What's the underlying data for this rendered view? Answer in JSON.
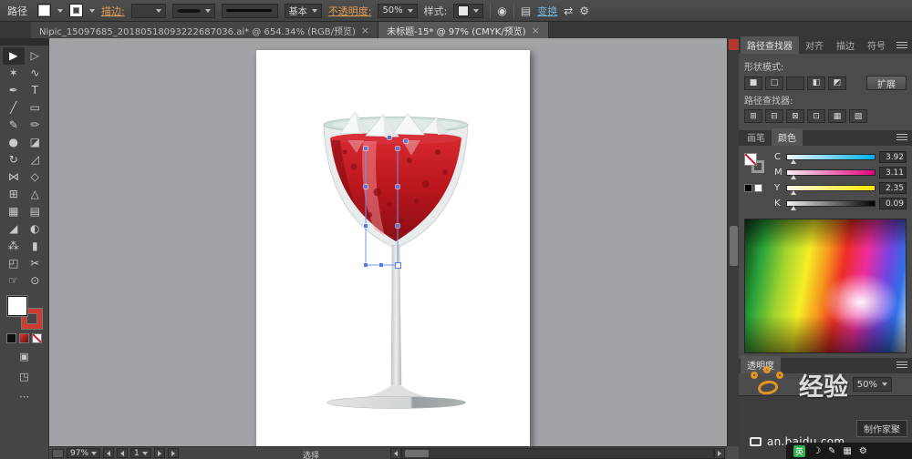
{
  "ui": {
    "close_glyph": "×"
  },
  "control_bar": {
    "selection_type": "路径",
    "stroke_label": "描边:",
    "brush_name": "基本",
    "opacity_label": "不透明度:",
    "opacity_value": "50%",
    "style_label": "样式:",
    "transform_link": "变换",
    "icons": {
      "recolor": "◉",
      "align": "▤",
      "swap": "⇄",
      "settings": "⚙"
    }
  },
  "document_tabs": [
    {
      "title": "Nipic_15097685_20180518093222687036.ai* @ 654.34% (RGB/预览)"
    },
    {
      "title": "未标题-15* @ 97% (CMYK/预览)"
    }
  ],
  "tools": [
    {
      "name": "selection",
      "glyph": "▶"
    },
    {
      "name": "direct-selection",
      "glyph": "▷"
    },
    {
      "name": "magic-wand",
      "glyph": "✶"
    },
    {
      "name": "lasso",
      "glyph": "∿"
    },
    {
      "name": "pen",
      "glyph": "✒"
    },
    {
      "name": "type",
      "glyph": "T"
    },
    {
      "name": "line-segment",
      "glyph": "╱"
    },
    {
      "name": "rectangle",
      "glyph": "▭"
    },
    {
      "name": "paintbrush",
      "glyph": "✎"
    },
    {
      "name": "pencil",
      "glyph": "✏"
    },
    {
      "name": "blob-brush",
      "glyph": "●"
    },
    {
      "name": "eraser",
      "glyph": "◪"
    },
    {
      "name": "rotate",
      "glyph": "↻"
    },
    {
      "name": "scale",
      "glyph": "◿"
    },
    {
      "name": "width",
      "glyph": "⋈"
    },
    {
      "name": "free-transform",
      "glyph": "◇"
    },
    {
      "name": "shape-builder",
      "glyph": "⊞"
    },
    {
      "name": "perspective-grid",
      "glyph": "△"
    },
    {
      "name": "mesh",
      "glyph": "▦"
    },
    {
      "name": "gradient",
      "glyph": "▤"
    },
    {
      "name": "eyedropper",
      "glyph": "◢"
    },
    {
      "name": "blend",
      "glyph": "◐"
    },
    {
      "name": "symbol-sprayer",
      "glyph": "⁂"
    },
    {
      "name": "column-graph",
      "glyph": "▮"
    },
    {
      "name": "artboard",
      "glyph": "◰"
    },
    {
      "name": "slice",
      "glyph": "✂"
    },
    {
      "name": "hand",
      "glyph": "☞"
    },
    {
      "name": "zoom",
      "glyph": "⊙"
    }
  ],
  "tool_extras": {
    "drawing_mode": "▣",
    "screen_mode": "◳",
    "more": "⋯"
  },
  "panels": {
    "pathfinder": {
      "tabs": [
        "路径查找器",
        "对齐",
        "描边",
        "符号"
      ],
      "shape_modes_label": "形状模式:",
      "shape_modes": [
        {
          "name": "unite",
          "glyph": "■"
        },
        {
          "name": "minus-front",
          "glyph": "□"
        },
        {
          "name": "intersect",
          "glyph": "◧"
        },
        {
          "name": "exclude",
          "glyph": "◩"
        }
      ],
      "expand_label": "扩展",
      "pathfinders_label": "路径查找器:",
      "pathfinders": [
        {
          "name": "divide",
          "glyph": "⊞"
        },
        {
          "name": "trim",
          "glyph": "⊟"
        },
        {
          "name": "merge",
          "glyph": "⊠"
        },
        {
          "name": "crop",
          "glyph": "⊡"
        },
        {
          "name": "outline",
          "glyph": "▦"
        },
        {
          "name": "minus-back",
          "glyph": "▧"
        }
      ]
    },
    "color": {
      "tabs": [
        "画笔",
        "颜色"
      ],
      "channels": [
        {
          "label": "C",
          "value": "3.92",
          "color": "#00aeef"
        },
        {
          "label": "M",
          "value": "3.11",
          "color": "#e6007e"
        },
        {
          "label": "Y",
          "value": "2.35",
          "color": "#ffe800"
        },
        {
          "label": "K",
          "value": "0.09",
          "color": "#000000"
        }
      ]
    },
    "transparency": {
      "title": "透明度",
      "opacity_value": "50%"
    }
  },
  "watermark": {
    "brand": "经验",
    "url": "an.baidu.com",
    "badge": "制作家聚"
  },
  "status_bar": {
    "zoom": "97%",
    "artboard_number": "1",
    "tool_hint": "选择"
  },
  "ime": {
    "lang": "英",
    "icons": [
      "☽",
      "✎",
      "▦",
      "⚙"
    ]
  }
}
